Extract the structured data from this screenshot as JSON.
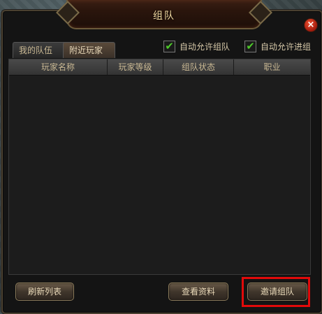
{
  "window": {
    "title": "组队"
  },
  "tabs": [
    {
      "label": "我的队伍",
      "active": false
    },
    {
      "label": "附近玩家",
      "active": true
    }
  ],
  "options": {
    "auto_allow_team": {
      "label": "自动允许组队",
      "checked": true
    },
    "auto_allow_join": {
      "label": "自动允许进组",
      "checked": true
    }
  },
  "table": {
    "columns": [
      "玩家名称",
      "玩家等级",
      "组队状态",
      "职业"
    ],
    "rows": []
  },
  "buttons": {
    "refresh": "刷新列表",
    "view_info": "查看资料",
    "invite": "邀请组队"
  },
  "icons": {
    "close": "close-icon",
    "check": "check-icon"
  },
  "colors": {
    "highlight": "#e10a0a",
    "check": "#4ec82a",
    "title": "#f0d8a0"
  }
}
